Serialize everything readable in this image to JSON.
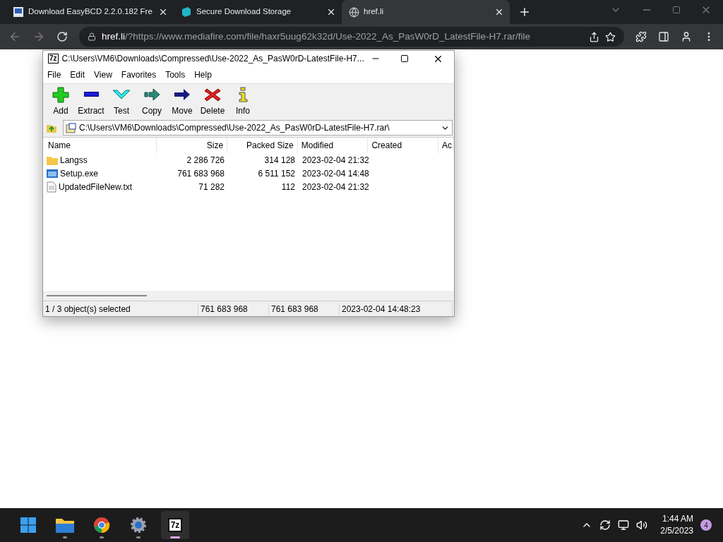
{
  "browser": {
    "tabs": [
      {
        "title": "Download EasyBCD 2.2.0.182 Fre",
        "selected": false
      },
      {
        "title": "Secure Download Storage",
        "selected": false
      },
      {
        "title": "href.li",
        "selected": true
      }
    ],
    "url_host": "href.li",
    "url_rest": "/?https://www.mediafire.com/file/haxr5uug62k32d/Use-2022_As_PasW0rD_LatestFile-H7.rar/file"
  },
  "window": {
    "logo": "7z",
    "title": "C:\\Users\\VM6\\Downloads\\Compressed\\Use-2022_As_PasW0rD-LatestFile-H7...",
    "menu": [
      "File",
      "Edit",
      "View",
      "Favorites",
      "Tools",
      "Help"
    ],
    "toolbar": [
      {
        "kind": "add",
        "label": "Add"
      },
      {
        "kind": "extract",
        "label": "Extract"
      },
      {
        "kind": "test",
        "label": "Test"
      },
      {
        "kind": "copy",
        "label": "Copy"
      },
      {
        "kind": "move",
        "label": "Move"
      },
      {
        "kind": "delete",
        "label": "Delete"
      },
      {
        "kind": "info",
        "label": "Info"
      }
    ],
    "path": "C:\\Users\\VM6\\Downloads\\Compressed\\Use-2022_As_PasW0rD-LatestFile-H7.rar\\",
    "columns": [
      "Name",
      "Size",
      "Packed Size",
      "Modified",
      "Created",
      "Ac"
    ],
    "rows": [
      {
        "kind": "folder",
        "name": "Langss",
        "size": "2 286 726",
        "packed": "314 128",
        "modified": "2023-02-04 21:32"
      },
      {
        "kind": "exe",
        "name": "Setup.exe",
        "size": "761 683 968",
        "packed": "6 511 152",
        "modified": "2023-02-04 14:48"
      },
      {
        "kind": "text",
        "name": "UpdatedFileNew.txt",
        "size": "71 282",
        "packed": "112",
        "modified": "2023-02-04 21:32"
      }
    ],
    "status": [
      "1 / 3 object(s) selected",
      "761 683 968",
      "761 683 968",
      "2023-02-04 14:48:23"
    ]
  },
  "taskbar": {
    "apps": [
      {
        "kind": "start"
      },
      {
        "kind": "folder",
        "active": false
      },
      {
        "kind": "chrome",
        "active": false
      },
      {
        "kind": "settings",
        "active": false
      },
      {
        "kind": "archiver",
        "active": true
      }
    ],
    "app_label": "7z",
    "time": "1:44 AM",
    "date": "2/5/2023",
    "badge": "4"
  }
}
